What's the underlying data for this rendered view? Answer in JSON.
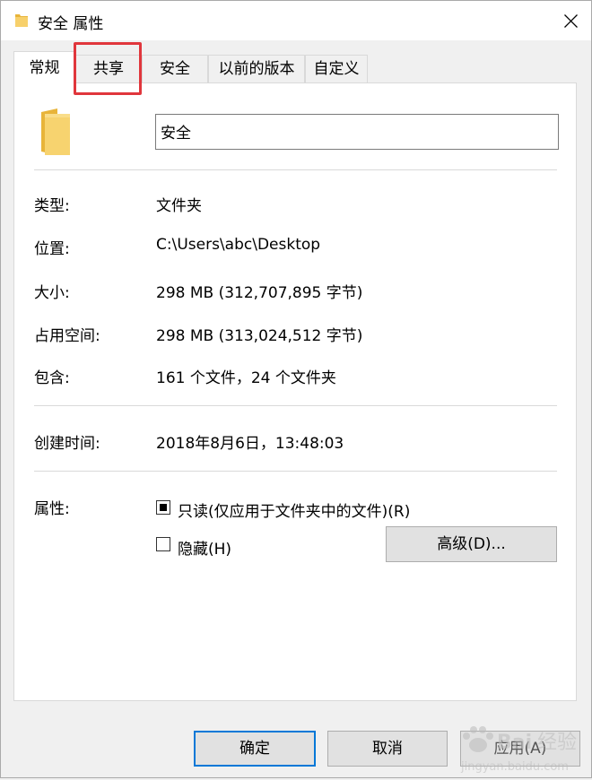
{
  "window": {
    "title": "安全 属性",
    "close_icon": "close-icon"
  },
  "tabs": [
    {
      "label": "常规",
      "active": true
    },
    {
      "label": "共享",
      "active": false
    },
    {
      "label": "安全",
      "active": false
    },
    {
      "label": "以前的版本",
      "active": false
    },
    {
      "label": "自定义",
      "active": false
    }
  ],
  "general": {
    "folder_name": "安全",
    "rows": {
      "type": {
        "label": "类型:",
        "value": "文件夹"
      },
      "location": {
        "label": "位置:",
        "value": "C:\\Users\\abc\\Desktop"
      },
      "size": {
        "label": "大小:",
        "value": "298 MB (312,707,895 字节)"
      },
      "size_on_disk": {
        "label": "占用空间:",
        "value": "298 MB (313,024,512 字节)"
      },
      "contains": {
        "label": "包含:",
        "value": "161 个文件，24 个文件夹"
      },
      "created": {
        "label": "创建时间:",
        "value": "2018年8月6日，13:48:03"
      }
    },
    "attributes": {
      "label": "属性:",
      "readonly_label": "只读(仅应用于文件夹中的文件)(R)",
      "readonly_state": "indeterminate",
      "hidden_label": "隐藏(H)",
      "hidden_checked": false,
      "advanced_button": "高级(D)..."
    }
  },
  "buttons": {
    "ok": "确定",
    "cancel": "取消",
    "apply": "应用(A)"
  },
  "watermark": {
    "text": "Baidu 经验",
    "subtext": "jingyan.baidu.com"
  },
  "colors": {
    "highlight_box": "#e0363c",
    "default_button_border": "#0078d7",
    "folder": "#f4c64f"
  }
}
